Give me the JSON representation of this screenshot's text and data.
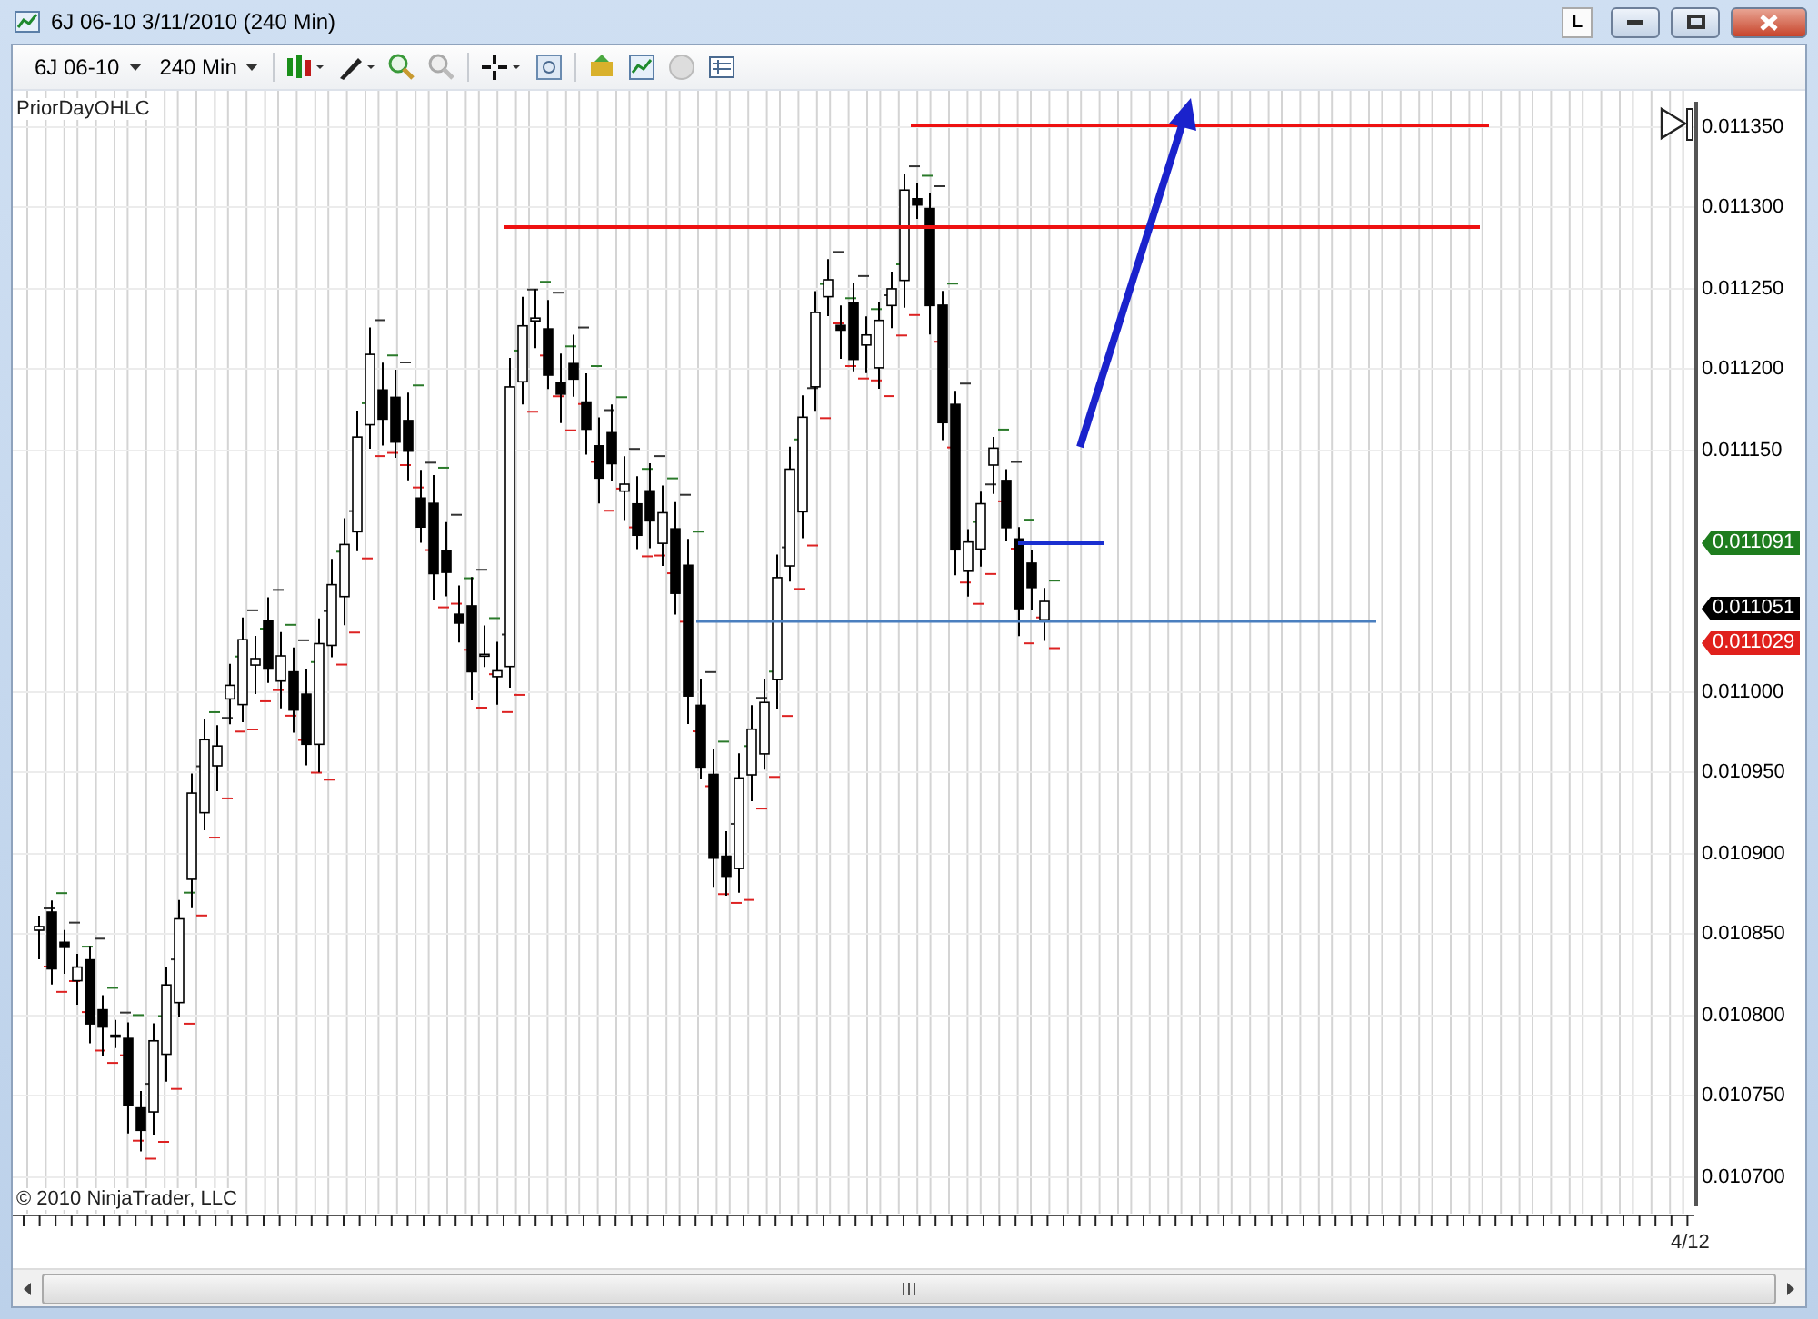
{
  "window": {
    "title": "6J 06-10  3/11/2010 (240 Min)",
    "controls": [
      "L"
    ]
  },
  "toolbar": {
    "instrument": "6J 06-10",
    "interval": "240 Min"
  },
  "chart": {
    "indicator": "PriorDayOHLC",
    "copyright": "© 2010 NinjaTrader, LLC",
    "date_label": "4/12",
    "y_axis": [
      "0.011350",
      "0.011300",
      "0.011250",
      "0.011200",
      "0.011150",
      "0.011000",
      "0.010950",
      "0.010900",
      "0.010850",
      "0.010800",
      "0.010750",
      "0.010700"
    ],
    "price_markers": [
      {
        "text": "0.011091",
        "color": "#1e7d1e"
      },
      {
        "text": "0.011051",
        "color": "#000000"
      },
      {
        "text": "0.011029",
        "color": "#e0201c"
      }
    ]
  }
}
